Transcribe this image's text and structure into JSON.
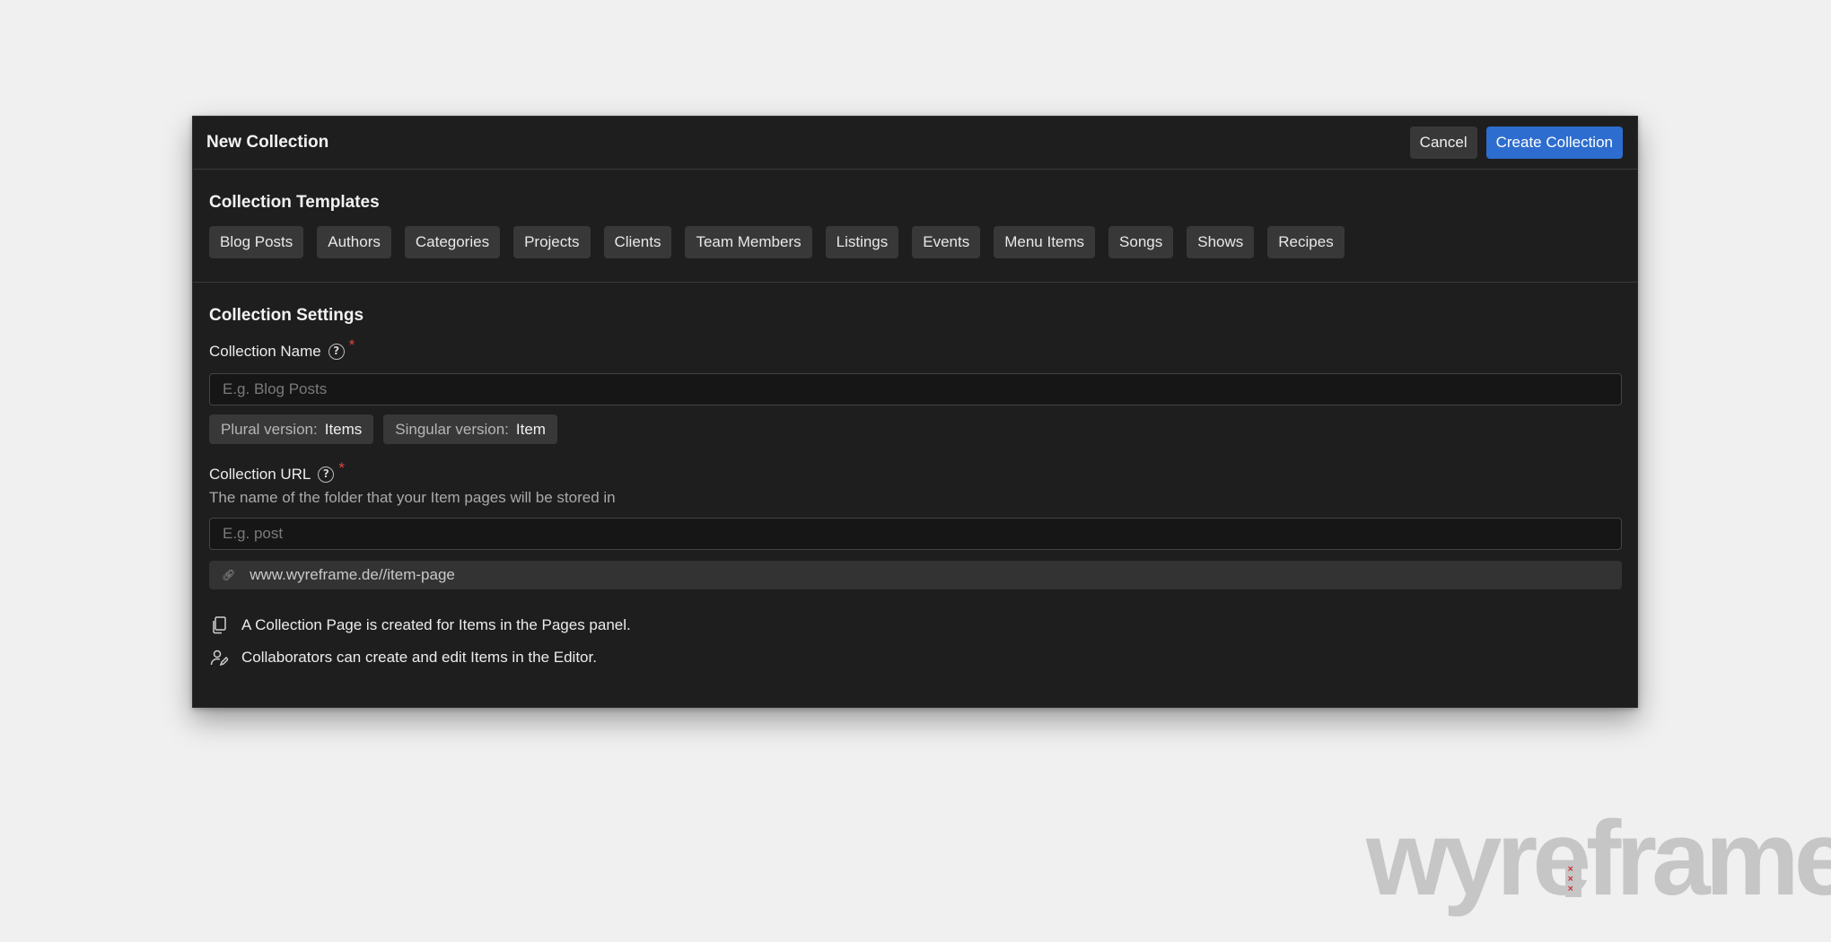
{
  "header": {
    "title": "New Collection",
    "cancel_label": "Cancel",
    "create_label": "Create Collection"
  },
  "templates": {
    "title": "Collection Templates",
    "items": [
      "Blog Posts",
      "Authors",
      "Categories",
      "Projects",
      "Clients",
      "Team Members",
      "Listings",
      "Events",
      "Menu Items",
      "Songs",
      "Shows",
      "Recipes"
    ]
  },
  "settings": {
    "title": "Collection Settings",
    "name_field": {
      "label": "Collection Name",
      "help": "?",
      "required": "*",
      "placeholder": "E.g. Blog Posts",
      "value": ""
    },
    "plural": {
      "key": "Plural version:",
      "value": "Items"
    },
    "singular": {
      "key": "Singular version:",
      "value": "Item"
    },
    "url_field": {
      "label": "Collection URL",
      "help": "?",
      "required": "*",
      "description": "The name of the folder that your Item pages will be stored in",
      "placeholder": "E.g. post",
      "value": ""
    },
    "url_preview": "www.wyreframe.de//item-page",
    "info": [
      {
        "icon": "pages-icon",
        "text": "A Collection Page is created for Items in the Pages panel."
      },
      {
        "icon": "collaborator-edit-icon",
        "text": "Collaborators can create and edit Items in the Editor."
      }
    ]
  },
  "watermark": {
    "text": "wyreframe",
    "mark": "×××"
  },
  "colors": {
    "background": "#f0f0f0",
    "modal": "#1e1e1e",
    "chip": "#383838",
    "accent": "#2d6dcf",
    "required": "#e0443e"
  }
}
